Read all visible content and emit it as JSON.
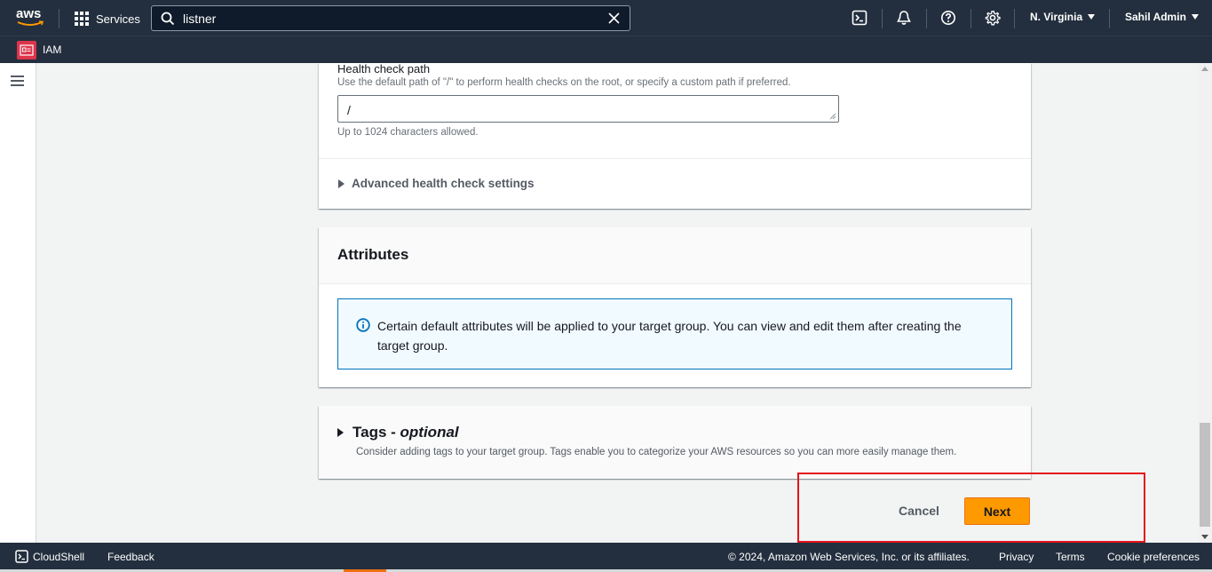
{
  "topnav": {
    "logo_text": "aws",
    "services_label": "Services",
    "search_value": "listner",
    "region_label": "N. Virginia",
    "user_label": "Sahil Admin"
  },
  "subnav": {
    "service_label": "IAM"
  },
  "health_check": {
    "path_label": "Health check path",
    "path_description": "Use the default path of \"/\" to perform health checks on the root, or specify a custom path if preferred.",
    "path_value": "/",
    "path_hint": "Up to 1024 characters allowed.",
    "advanced_label": "Advanced health check settings"
  },
  "attributes": {
    "title": "Attributes",
    "info_text": "Certain default attributes will be applied to your target group. You can view and edit them after creating the target group."
  },
  "tags": {
    "title": "Tags - ",
    "optional": "optional",
    "description": "Consider adding tags to your target group. Tags enable you to categorize your AWS resources so you can more easily manage them."
  },
  "actions": {
    "cancel_label": "Cancel",
    "next_label": "Next"
  },
  "footer": {
    "cloudshell_label": "CloudShell",
    "feedback_label": "Feedback",
    "copyright": "© 2024, Amazon Web Services, Inc. or its affiliates.",
    "privacy": "Privacy",
    "terms": "Terms",
    "cookie": "Cookie preferences"
  },
  "colors": {
    "nav_bg": "#232f3e",
    "primary_button": "#ff9900",
    "info_border": "#0073bb",
    "highlight": "#e4141b",
    "iam_badge": "#dd344c"
  }
}
